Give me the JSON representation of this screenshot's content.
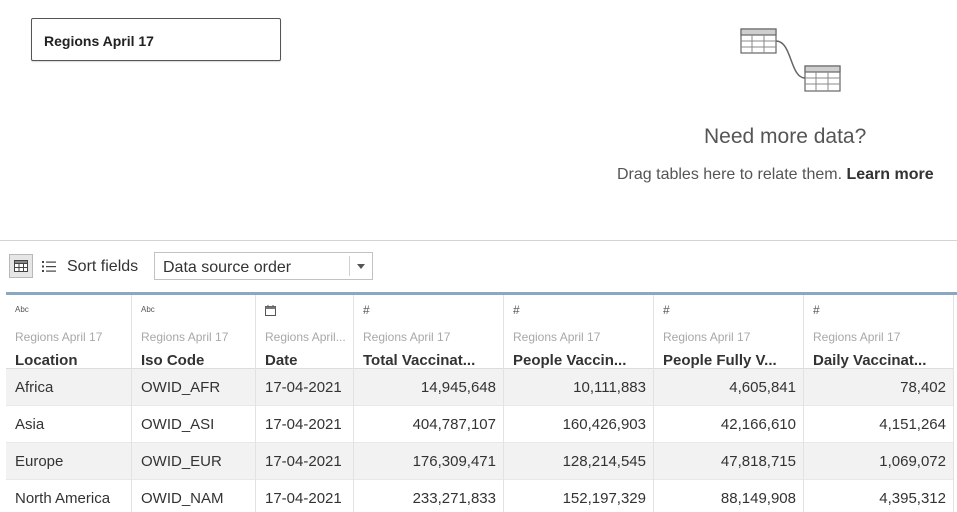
{
  "table_card": {
    "title": "Regions April 17"
  },
  "empty_state": {
    "heading": "Need more data?",
    "text": "Drag tables here to relate them.",
    "link": "Learn more"
  },
  "toolbar": {
    "sort_label": "Sort fields",
    "sort_value": "Data source order"
  },
  "columns": [
    {
      "type": "Abc",
      "source": "Regions April 17",
      "name": "Location"
    },
    {
      "type": "Abc",
      "source": "Regions April 17",
      "name": "Iso Code"
    },
    {
      "type": "calendar-icon",
      "source": "Regions April...",
      "name": "Date"
    },
    {
      "type": "#",
      "source": "Regions April 17",
      "name": "Total Vaccinat..."
    },
    {
      "type": "#",
      "source": "Regions April 17",
      "name": "People Vaccin..."
    },
    {
      "type": "#",
      "source": "Regions April 17",
      "name": "People Fully V..."
    },
    {
      "type": "#",
      "source": "Regions April 17",
      "name": "Daily Vaccinat..."
    }
  ],
  "rows": [
    [
      "Africa",
      "OWID_AFR",
      "17-04-2021",
      "14,945,648",
      "10,111,883",
      "4,605,841",
      "78,402"
    ],
    [
      "Asia",
      "OWID_ASI",
      "17-04-2021",
      "404,787,107",
      "160,426,903",
      "42,166,610",
      "4,151,264"
    ],
    [
      "Europe",
      "OWID_EUR",
      "17-04-2021",
      "176,309,471",
      "128,214,545",
      "47,818,715",
      "1,069,072"
    ],
    [
      "North America",
      "OWID_NAM",
      "17-04-2021",
      "233,271,833",
      "152,197,329",
      "88,149,908",
      "4,395,312"
    ]
  ]
}
